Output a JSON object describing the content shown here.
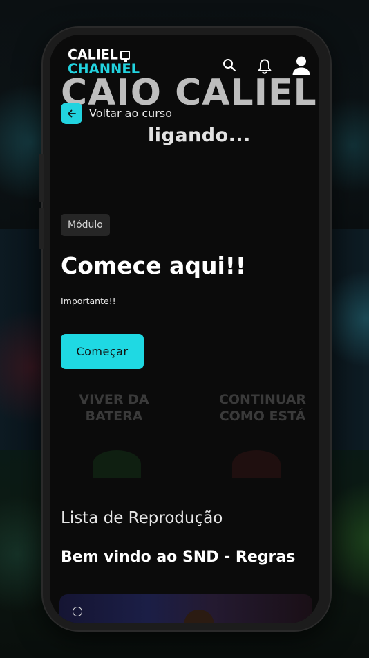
{
  "app": {
    "logo_top": "CALIEL",
    "logo_bottom": "CHANNEL",
    "accent_color": "#22d3df"
  },
  "header": {
    "icons": [
      "search-icon",
      "bell-icon",
      "user-icon"
    ]
  },
  "banner": {
    "title": "CAIO CALIEL",
    "status": "ligando..."
  },
  "back": {
    "label": "Voltar ao curso",
    "icon": "arrow-left-icon"
  },
  "module": {
    "badge": "Módulo",
    "title": "Comece aqui!!",
    "description": "Importante!!",
    "start_label": "Começar"
  },
  "background_options": {
    "left": "VIVER DA BATERA",
    "right": "CONTINUAR COMO ESTÁ"
  },
  "playlist": {
    "heading": "Lista de Reprodução",
    "current_title": "Bem vindo ao SND - Regras"
  }
}
